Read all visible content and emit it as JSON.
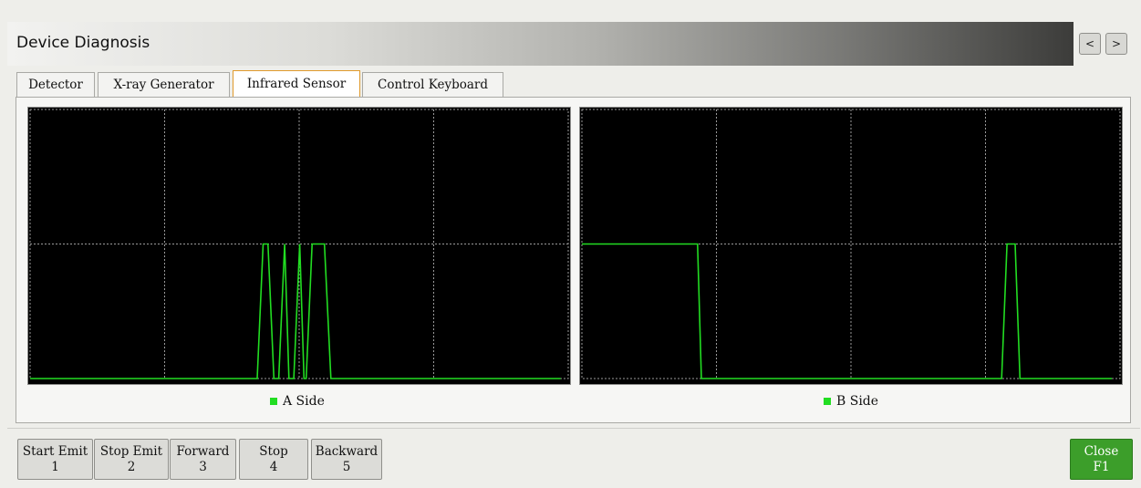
{
  "window": {
    "title": "Device Diagnosis",
    "prev_label": "<",
    "next_label": ">"
  },
  "tabs": [
    {
      "label": "Detector",
      "active": false
    },
    {
      "label": "X-ray Generator",
      "active": false
    },
    {
      "label": "Infrared Sensor",
      "active": true
    },
    {
      "label": "Control Keyboard",
      "active": false
    }
  ],
  "colors": {
    "signal": "#22dd22",
    "grid": "#9a9a9a",
    "plot_bg": "#000000",
    "legend_a": "#22dd22",
    "legend_b": "#22dd22",
    "close_bg": "#3c9e2a"
  },
  "chart_data": [
    {
      "type": "line",
      "legend": "A Side",
      "xlim": [
        0,
        100
      ],
      "ylim": [
        0,
        2
      ],
      "grid": true,
      "legend_placement": "bottom-center",
      "points": [
        [
          0,
          0
        ],
        [
          42.2,
          0
        ],
        [
          43.3,
          1
        ],
        [
          44.2,
          1
        ],
        [
          45.3,
          0
        ],
        [
          46.2,
          0
        ],
        [
          47.3,
          1
        ],
        [
          48.1,
          0
        ],
        [
          49.0,
          0
        ],
        [
          50.1,
          1
        ],
        [
          50.9,
          0
        ],
        [
          51.3,
          0
        ],
        [
          52.4,
          1
        ],
        [
          54.7,
          1
        ],
        [
          55.9,
          0
        ],
        [
          98.6,
          0
        ]
      ]
    },
    {
      "type": "line",
      "legend": "B Side",
      "xlim": [
        0,
        100
      ],
      "ylim": [
        0,
        2
      ],
      "grid": true,
      "legend_placement": "bottom-center",
      "points": [
        [
          0,
          1
        ],
        [
          21.5,
          1
        ],
        [
          22.2,
          0
        ],
        [
          78.0,
          0
        ],
        [
          79.0,
          1
        ],
        [
          80.5,
          1
        ],
        [
          81.4,
          0
        ],
        [
          98.5,
          0
        ]
      ]
    }
  ],
  "buttons": [
    {
      "label": "Start Emit",
      "key": "1"
    },
    {
      "label": "Stop Emit",
      "key": "2"
    },
    {
      "label": "Forward",
      "key": "3"
    },
    {
      "label": "Stop",
      "key": "4"
    },
    {
      "label": "Backward",
      "key": "5"
    }
  ],
  "close_button": {
    "label": "Close",
    "key": "F1"
  }
}
